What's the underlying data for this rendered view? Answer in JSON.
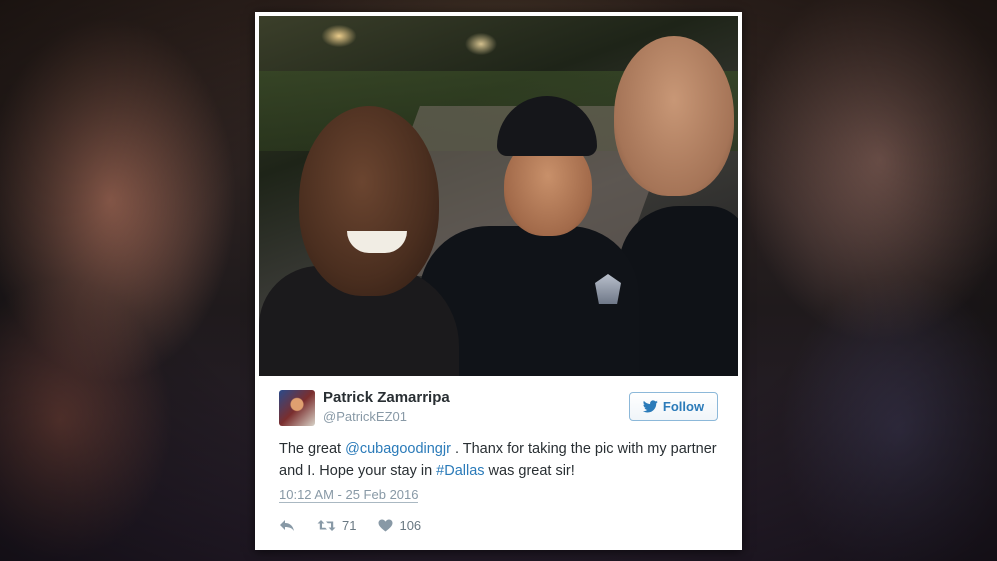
{
  "tweet": {
    "author": {
      "display_name": "Patrick Zamarripa",
      "screen_name": "@PatrickEZ01"
    },
    "follow_label": "Follow",
    "text": {
      "part1": "The great ",
      "mention": "@cubagoodingjr",
      "part2": " . Thanx for taking the pic with my partner and I. Hope your stay in ",
      "hashtag": "#Dallas",
      "part3": " was great sir!"
    },
    "timestamp": "10:12 AM - 25 Feb 2016",
    "retweet_count": "71",
    "like_count": "106"
  },
  "icons": {
    "follow": "twitter-bird-icon",
    "reply": "reply-icon",
    "retweet": "retweet-icon",
    "like": "heart-icon"
  },
  "colors": {
    "link": "#2b7bb9",
    "text": "#292f33",
    "muted": "#8899a6"
  }
}
